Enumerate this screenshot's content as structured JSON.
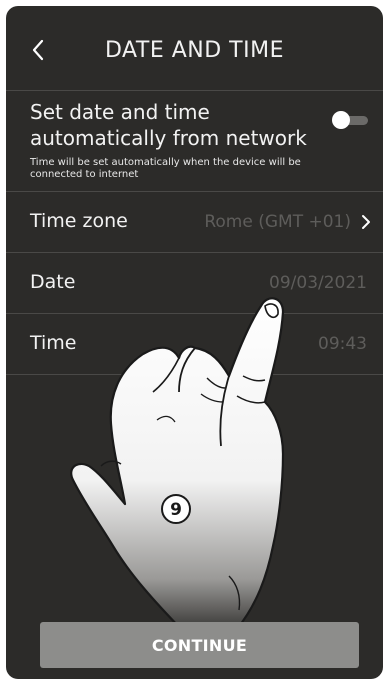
{
  "header": {
    "title": "DATE AND TIME",
    "back_icon": "chevron-left-icon"
  },
  "auto_sync": {
    "label": "Set date and time automatically from network",
    "hint": "Time will be set automatically when the device will be connected to internet",
    "enabled": false
  },
  "rows": [
    {
      "label": "Time zone",
      "value": "Rome (GMT +01)",
      "icon": "chevron-right-icon"
    },
    {
      "label": "Date",
      "value": "09/03/2021"
    },
    {
      "label": "Time",
      "value": "09:43"
    }
  ],
  "illustration": {
    "step_number": "9",
    "icon": "pointing-hand-icon"
  },
  "footer": {
    "continue_label": "CONTINUE"
  },
  "colors": {
    "background": "#2c2b29",
    "divider": "#4a4947",
    "muted_value": "#5e5d5b",
    "button": "#8d8d8b"
  }
}
